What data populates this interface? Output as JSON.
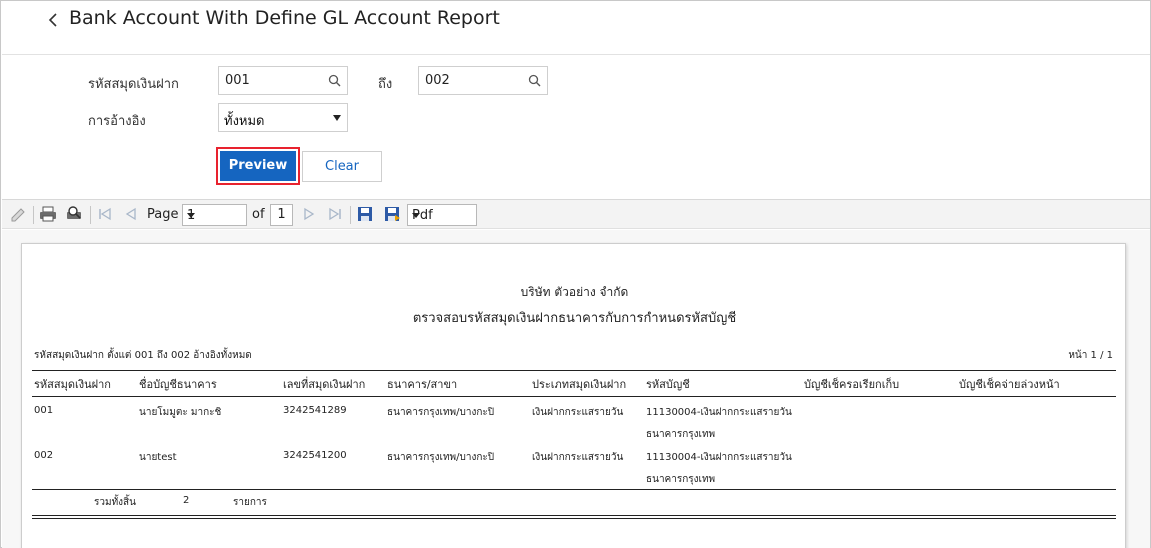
{
  "header": {
    "title": "Bank Account With Define GL Account Report"
  },
  "form": {
    "bank_account_label": "รหัสสมุดเงินฝาก",
    "from_value": "001",
    "to_label": "ถึง",
    "to_value": "002",
    "reference_label": "การอ้างอิง",
    "reference_value": "ทั้งหมด",
    "preview_label": "Preview",
    "clear_label": "Clear"
  },
  "toolbar": {
    "page_label": "Page",
    "page_value": "1",
    "of_label": "of",
    "total_pages": "1",
    "format_value": "Pdf"
  },
  "report": {
    "company": "บริษัท ตัวอย่าง จำกัด",
    "title": "ตรวจสอบรหัสสมุดเงินฝากธนาคารกับการกำหนดรหัสบัญชี",
    "criteria": "รหัสสมุดเงินฝาก ตั้งแต่ 001 ถึง 002 อ้างอิงทั้งหมด",
    "page_no": "หน้า 1 / 1",
    "columns": [
      "รหัสสมุดเงินฝาก",
      "ชื่อบัญชีธนาคาร",
      "เลขที่สมุดเงินฝาก",
      "ธนาคาร/สาขา",
      "ประเภทสมุดเงินฝาก",
      "รหัสบัญชี",
      "บัญชีเช็ครอเรียกเก็บ",
      "บัญชีเช็คจ่ายล่วงหน้า"
    ],
    "rows": [
      {
        "code": "001",
        "name": "นายโมมูตะ มากะชิ",
        "number": "3242541289",
        "bank": "ธนาคารกรุงเทพ/บางกะปิ",
        "type": "เงินฝากกระแสรายวัน",
        "account_line1": "11130004-เงินฝากกระแสรายวัน",
        "account_line2": "ธนาคารกรุงเทพ"
      },
      {
        "code": "002",
        "name": "นายtest",
        "number": "3242541200",
        "bank": "ธนาคารกรุงเทพ/บางกะปิ",
        "type": "เงินฝากกระแสรายวัน",
        "account_line1": "11130004-เงินฝากกระแสรายวัน",
        "account_line2": "ธนาคารกรุงเทพ"
      }
    ],
    "total_label": "รวมทั้งสิ้น",
    "total_count": "2",
    "total_unit": "รายการ"
  }
}
